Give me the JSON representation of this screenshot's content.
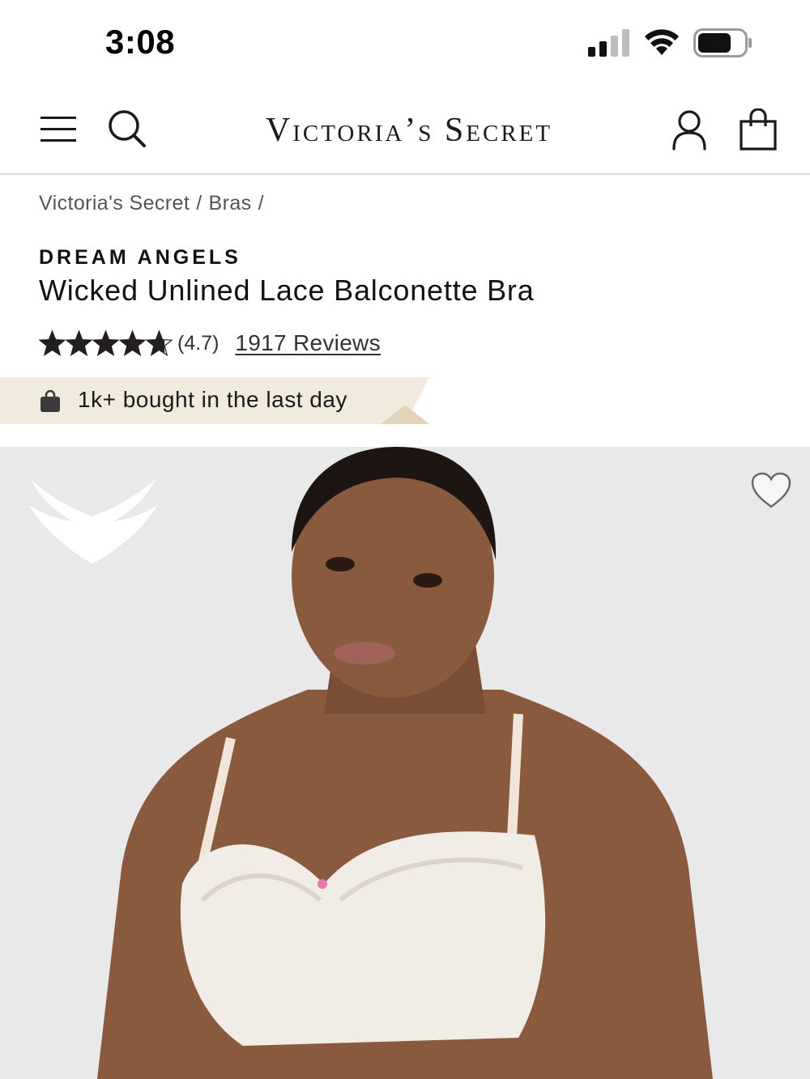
{
  "status_bar": {
    "time": "3:08",
    "icons": [
      "signal-icon",
      "wifi-icon",
      "battery-icon"
    ]
  },
  "header": {
    "brand": "Victoria’s Secret",
    "icons": [
      "menu-icon",
      "search-icon",
      "account-icon",
      "shopping-bag-icon"
    ]
  },
  "breadcrumb": {
    "items": [
      "Victoria's Secret",
      "Bras"
    ],
    "separator": "/"
  },
  "product": {
    "collection": "DREAM ANGELS",
    "title": "Wicked Unlined Lace Balconette Bra",
    "rating": {
      "value": 4.7,
      "display": "(4.7)",
      "reviews_label": "1917 Reviews"
    },
    "social_proof": "1k+ bought in the last day",
    "image_icons": [
      "angel-wings-logo",
      "heart-icon"
    ]
  },
  "colors": {
    "banner_bg": "#f1ebde",
    "banner_fold": "#e3d3b8",
    "image_bg": "#e9e9e9",
    "star": "#231f20"
  }
}
